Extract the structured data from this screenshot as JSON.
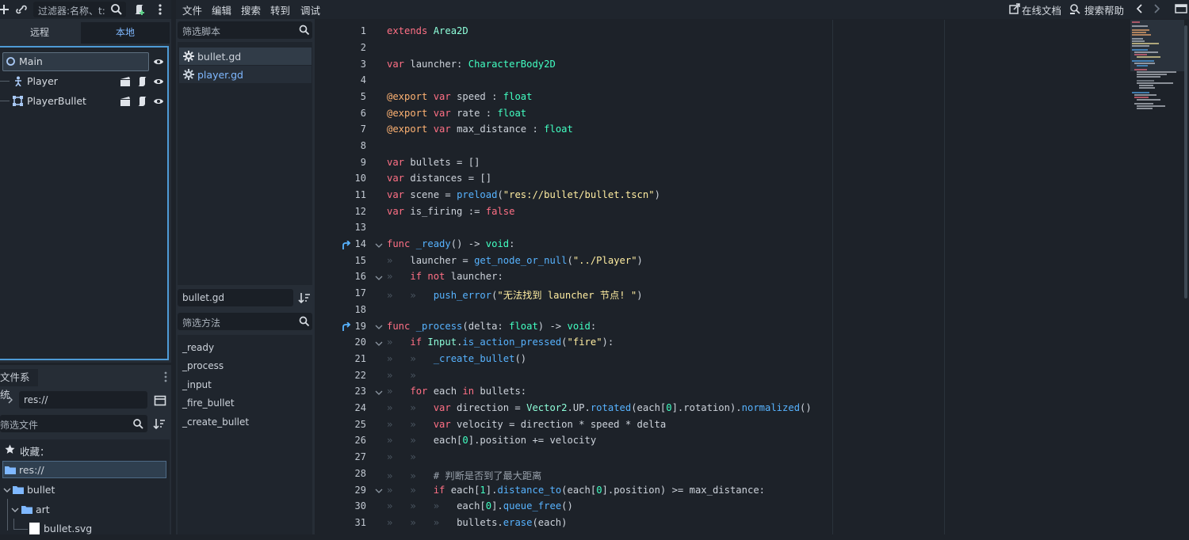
{
  "scene_dock": {
    "filter_placeholder": "过滤器:名称、t:",
    "tab_remote": "远程",
    "tab_local": "本地",
    "nodes": [
      "Main",
      "Player",
      "PlayerBullet"
    ]
  },
  "filesystem": {
    "title": "文件系统",
    "path": "res://",
    "filter_placeholder": "筛选文件",
    "favorites": "收藏：",
    "items": [
      "res://",
      "bullet",
      "art",
      "bullet.svg"
    ]
  },
  "scripts": {
    "filter_placeholder": "筛选脚本",
    "list": [
      "bullet.gd",
      "player.gd"
    ],
    "current": "bullet.gd",
    "method_filter_placeholder": "筛选方法",
    "methods": [
      "_ready",
      "_process",
      "_input",
      "_fire_bullet",
      "_create_bullet"
    ]
  },
  "menu": {
    "items": [
      "文件",
      "编辑",
      "搜索",
      "转到",
      "调试"
    ],
    "online_docs": "在线文档",
    "search_help": "搜索帮助"
  },
  "editor": {
    "line_numbers": [
      "1",
      "2",
      "3",
      "4",
      "5",
      "6",
      "7",
      "8",
      "9",
      "10",
      "11",
      "12",
      "13",
      "14",
      "15",
      "16",
      "17",
      "18",
      "19",
      "20",
      "21",
      "22",
      "23",
      "24",
      "25",
      "26",
      "27",
      "28",
      "29",
      "30",
      "31"
    ],
    "code": {
      "l1a": "extends",
      "l1b": " Area2D",
      "l3a": "var",
      "l3b": " launcher: ",
      "l3c": "CharacterBody2D",
      "l5a": "@export",
      "l5b": " var",
      "l5c": " speed : ",
      "l5d": "float",
      "l6a": "@export",
      "l6b": " var",
      "l6c": " rate : ",
      "l6d": "float",
      "l7a": "@export",
      "l7b": " var",
      "l7c": " max_distance : ",
      "l7d": "float",
      "l9a": "var",
      "l9b": " bullets = []",
      "l10a": "var",
      "l10b": " distances = []",
      "l11a": "var",
      "l11b": " scene = ",
      "l11c": "preload",
      "l11d": "(",
      "l11e": "\"res://bullet/bullet.tscn\"",
      "l11f": ")",
      "l12a": "var",
      "l12b": " is_firing := ",
      "l12c": "false",
      "l14a": "func",
      "l14b": " _ready",
      "l14c": "() -> ",
      "l14d": "void",
      "l14e": ":",
      "l15a": "launcher = ",
      "l15b": "get_node_or_null",
      "l15c": "(",
      "l15d": "\"../Player\"",
      "l15e": ")",
      "l16a": "if",
      "l16b": " not",
      "l16c": " launcher:",
      "l17a": "push_error",
      "l17b": "(",
      "l17c": "\"无法找到 launcher 节点! \"",
      "l17d": ")",
      "l19a": "func",
      "l19b": " _process",
      "l19c": "(delta: ",
      "l19d": "float",
      "l19e": ") -> ",
      "l19f": "void",
      "l19g": ":",
      "l20a": "if",
      "l20b": " Input",
      "l20c": ".",
      "l20d": "is_action_pressed",
      "l20e": "(",
      "l20f": "\"fire\"",
      "l20g": "):",
      "l21a": "_create_bullet",
      "l21b": "()",
      "l23a": "for",
      "l23b": " each ",
      "l23c": "in",
      "l23d": " bullets:",
      "l24a": "var",
      "l24b": " direction = ",
      "l24c": "Vector2",
      "l24d": ".UP.",
      "l24e": "rotated",
      "l24f": "(each[",
      "l24g": "0",
      "l24h": "].rotation).",
      "l24i": "normalized",
      "l24j": "()",
      "l25a": "var",
      "l25b": " velocity = direction * speed * delta",
      "l26a": "each[",
      "l26b": "0",
      "l26c": "].position += velocity",
      "l28a": "# 判断是否到了最大距离",
      "l29a": "if",
      "l29b": " each[",
      "l29c": "1",
      "l29d": "].",
      "l29e": "distance_to",
      "l29f": "(each[",
      "l29g": "0",
      "l29h": "].position) >= max_distance:",
      "l30a": "each[",
      "l30b": "0",
      "l30c": "].",
      "l30d": "queue_free",
      "l30e": "()",
      "l31a": "bullets.",
      "l31b": "erase",
      "l31c": "(each)"
    }
  },
  "colors": {
    "keyword": "#ff7085",
    "type": "#42ffc2",
    "function": "#57b3ff",
    "string": "#ffeda1",
    "annotation": "#ffb373",
    "accent": "#4e9bd6"
  }
}
